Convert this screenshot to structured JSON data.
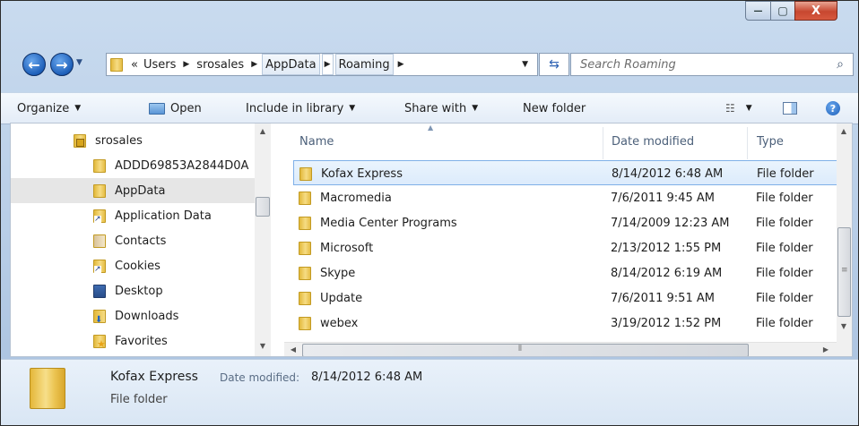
{
  "window": {
    "minimize_glyph": "—",
    "maximize_glyph": "▢",
    "close_glyph": "X"
  },
  "address": {
    "overflow": "«",
    "crumbs": [
      "Users",
      "srosales",
      "AppData",
      "Roaming"
    ]
  },
  "search": {
    "placeholder": "Search Roaming"
  },
  "toolbar": {
    "organize": "Organize",
    "open": "Open",
    "include_in_library": "Include in library",
    "share_with": "Share with",
    "new_folder": "New folder"
  },
  "nav_pane": {
    "items": [
      {
        "label": "srosales",
        "icon": "user-folder-icon"
      },
      {
        "label": "ADDD69853A2844D0A",
        "icon": "folder-icon"
      },
      {
        "label": "AppData",
        "icon": "folder-icon",
        "selected": true
      },
      {
        "label": "Application Data",
        "icon": "shortcut-folder-icon"
      },
      {
        "label": "Contacts",
        "icon": "contacts-icon"
      },
      {
        "label": "Cookies",
        "icon": "shortcut-folder-icon"
      },
      {
        "label": "Desktop",
        "icon": "desktop-icon"
      },
      {
        "label": "Downloads",
        "icon": "downloads-icon"
      },
      {
        "label": "Favorites",
        "icon": "favorites-icon"
      }
    ]
  },
  "file_list": {
    "columns": {
      "name": "Name",
      "date": "Date modified",
      "type": "Type"
    },
    "rows": [
      {
        "name": "Kofax Express",
        "date": "8/14/2012 6:48 AM",
        "type": "File folder",
        "selected": true
      },
      {
        "name": "Macromedia",
        "date": "7/6/2011 9:45 AM",
        "type": "File folder"
      },
      {
        "name": "Media Center Programs",
        "date": "7/14/2009 12:23 AM",
        "type": "File folder"
      },
      {
        "name": "Microsoft",
        "date": "2/13/2012 1:55 PM",
        "type": "File folder"
      },
      {
        "name": "Skype",
        "date": "8/14/2012 6:19 AM",
        "type": "File folder"
      },
      {
        "name": "Update",
        "date": "7/6/2011 9:51 AM",
        "type": "File folder"
      },
      {
        "name": "webex",
        "date": "3/19/2012 1:52 PM",
        "type": "File folder"
      }
    ]
  },
  "details_pane": {
    "name": "Kofax Express",
    "date_label": "Date modified:",
    "date_value": "8/14/2012 6:48 AM",
    "type": "File folder"
  },
  "colors": {
    "selection_border": "#7fb0e8",
    "selection_fill": "#dcebfc",
    "close_button": "#c7472f",
    "nav_button": "#1d5fb9"
  }
}
